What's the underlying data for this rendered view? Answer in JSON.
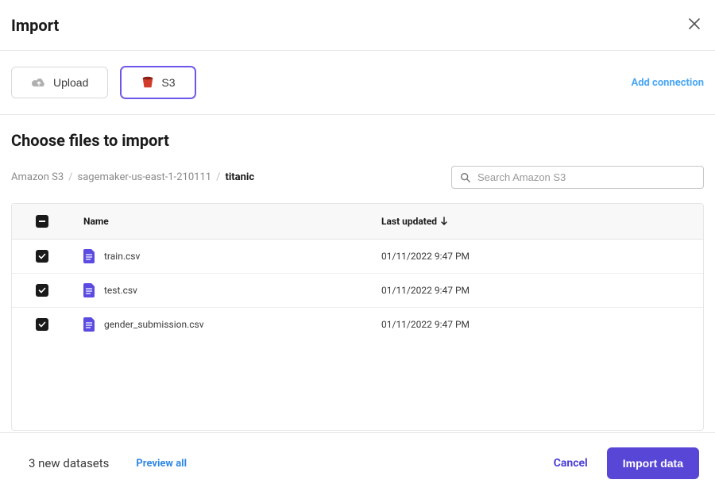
{
  "header": {
    "title": "Import"
  },
  "tabs": {
    "upload_label": "Upload",
    "s3_label": "S3",
    "add_connection": "Add connection"
  },
  "section": {
    "heading": "Choose files to import"
  },
  "breadcrumb": {
    "items": [
      "Amazon S3",
      "sagemaker-us-east-1-210111"
    ],
    "current": "titanic",
    "sep": "/"
  },
  "search": {
    "placeholder": "Search Amazon S3"
  },
  "table": {
    "headers": {
      "name": "Name",
      "last_updated": "Last updated"
    },
    "rows": [
      {
        "name": "train.csv",
        "date": "01/11/2022 9:47 PM",
        "checked": true
      },
      {
        "name": "test.csv",
        "date": "01/11/2022 9:47 PM",
        "checked": true
      },
      {
        "name": "gender_submission.csv",
        "date": "01/11/2022 9:47 PM",
        "checked": true
      }
    ]
  },
  "footer": {
    "count_text": "3 new datasets",
    "preview_all": "Preview all",
    "cancel": "Cancel",
    "import": "Import data"
  },
  "colors": {
    "accent": "#5846d6",
    "link": "#4aa7f5",
    "icon_purple": "#5b4be0",
    "icon_red": "#d13c2b"
  }
}
